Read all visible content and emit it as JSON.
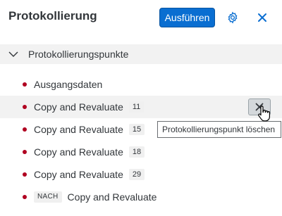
{
  "header": {
    "title": "Protokollierung",
    "run_label": "Ausführen",
    "settings_icon": "gear-icon",
    "close_icon": "close-icon"
  },
  "section": {
    "label": "Protokollierungspunkte",
    "expanded": true
  },
  "items": [
    {
      "label": "Ausgangsdaten",
      "badge": ""
    },
    {
      "label": "Copy and Revaluate",
      "badge": "11",
      "hovered": true
    },
    {
      "label": "Copy and Revaluate",
      "badge": "15"
    },
    {
      "label": "Copy and Revaluate",
      "badge": "18"
    },
    {
      "label": "Copy and Revaluate",
      "badge": "29"
    },
    {
      "label": "Copy and Revaluate",
      "prefix_badge": "NACH"
    }
  ],
  "tooltip": "Protokollierungspunkt löschen",
  "colors": {
    "accent": "#0a6ed1",
    "dot": "#b00020",
    "hover_bg": "#f2f2f2"
  }
}
